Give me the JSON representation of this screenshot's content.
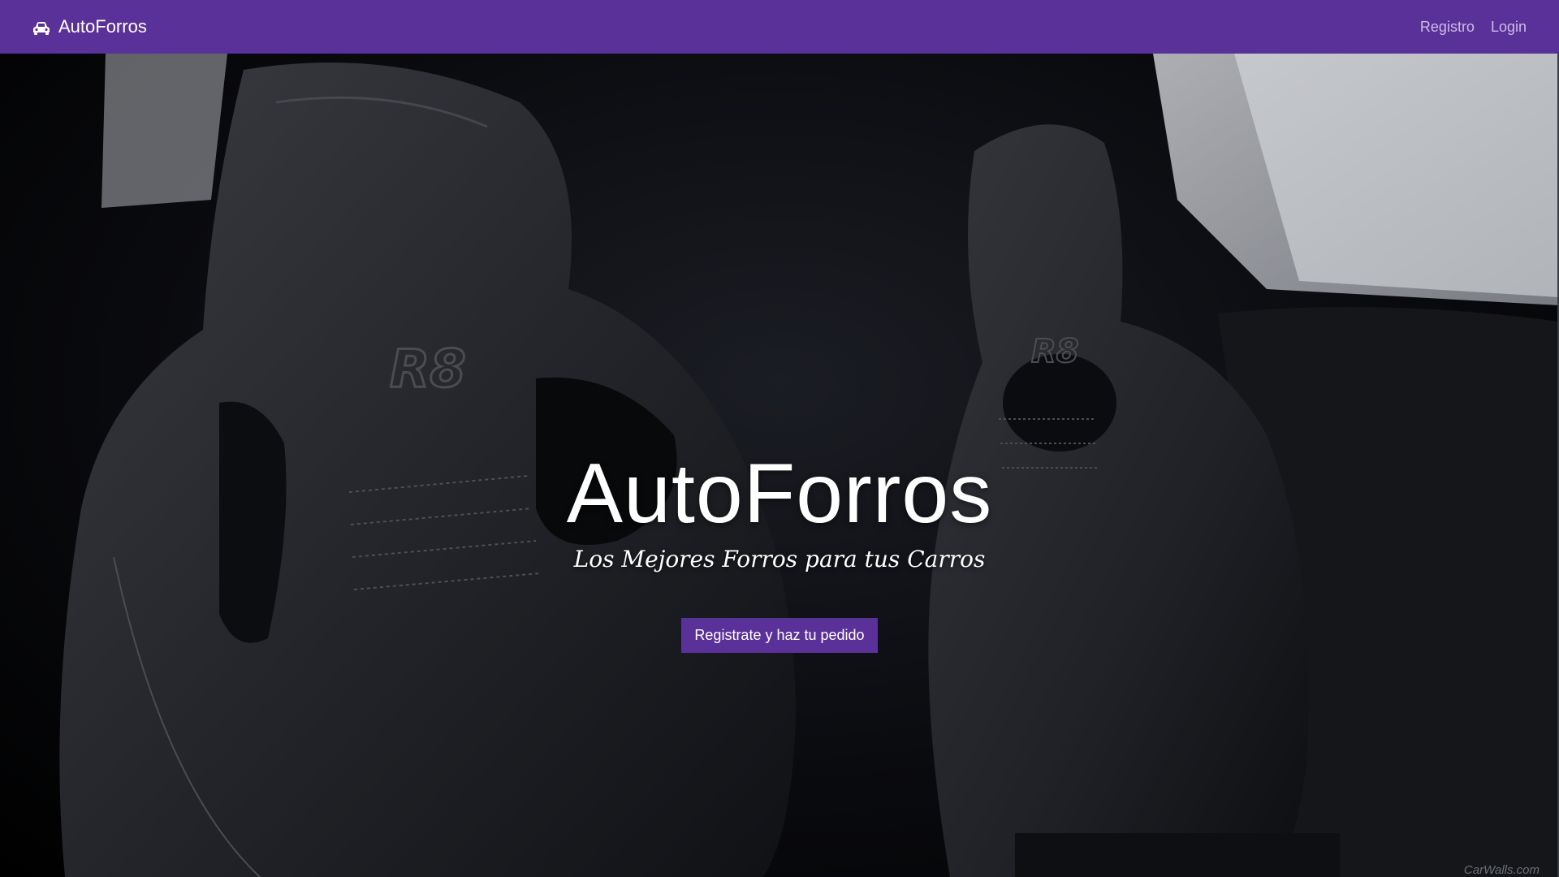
{
  "navbar": {
    "brand_icon": "car-icon",
    "brand_label": "AutoForros",
    "links": [
      {
        "label": "Registro"
      },
      {
        "label": "Login"
      }
    ],
    "color": "#5a3199"
  },
  "hero": {
    "title": "AutoForros",
    "subtitle": "Los Mejores Forros para tus Carros",
    "cta_label": "Registrate y haz tu pedido",
    "background": "black leather R8 sports seats",
    "watermark": "CarWalls.com"
  }
}
